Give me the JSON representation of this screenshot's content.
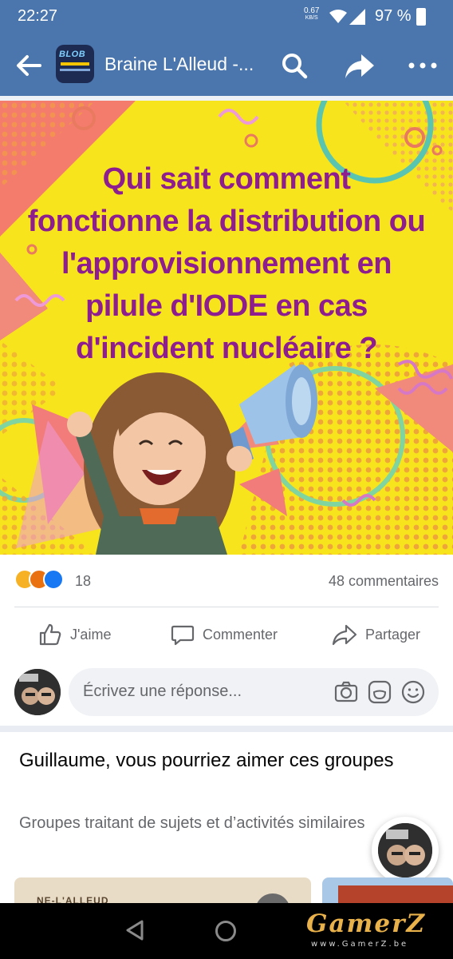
{
  "status_bar": {
    "time": "22:27",
    "net_rate_value": "0.67",
    "net_rate_unit": "KB/S",
    "battery_percent": "97 %"
  },
  "app_bar": {
    "group_name": "Braine L'Alleud -...",
    "logo_text": "BLOB"
  },
  "post": {
    "image_headline": "Qui sait comment fonctionne la distribution ou  l'approvisionnement en pilule d'IODE en cas d'incident nucléaire ?",
    "reaction_count": "18",
    "comment_count": "48 commentaires",
    "reactions": [
      "haha-reaction",
      "angry-reaction",
      "like-reaction"
    ]
  },
  "actions": {
    "like": "J'aime",
    "comment": "Commenter",
    "share": "Partager"
  },
  "composer": {
    "placeholder": "Écrivez une réponse..."
  },
  "suggestions": {
    "title": "Guillaume, vous pourriez aimer ces groupes",
    "subtitle": "Groupes traitant de sujets et d’activités similaires",
    "card_1_label": "NE-L'ALLEUD"
  },
  "watermark": {
    "brand": "GamerZ",
    "url": "www.GamerZ.be"
  },
  "colors": {
    "app_bar": "#4a76ad",
    "headline": "#8e1d8f",
    "image_bg": "#f7e41c"
  }
}
